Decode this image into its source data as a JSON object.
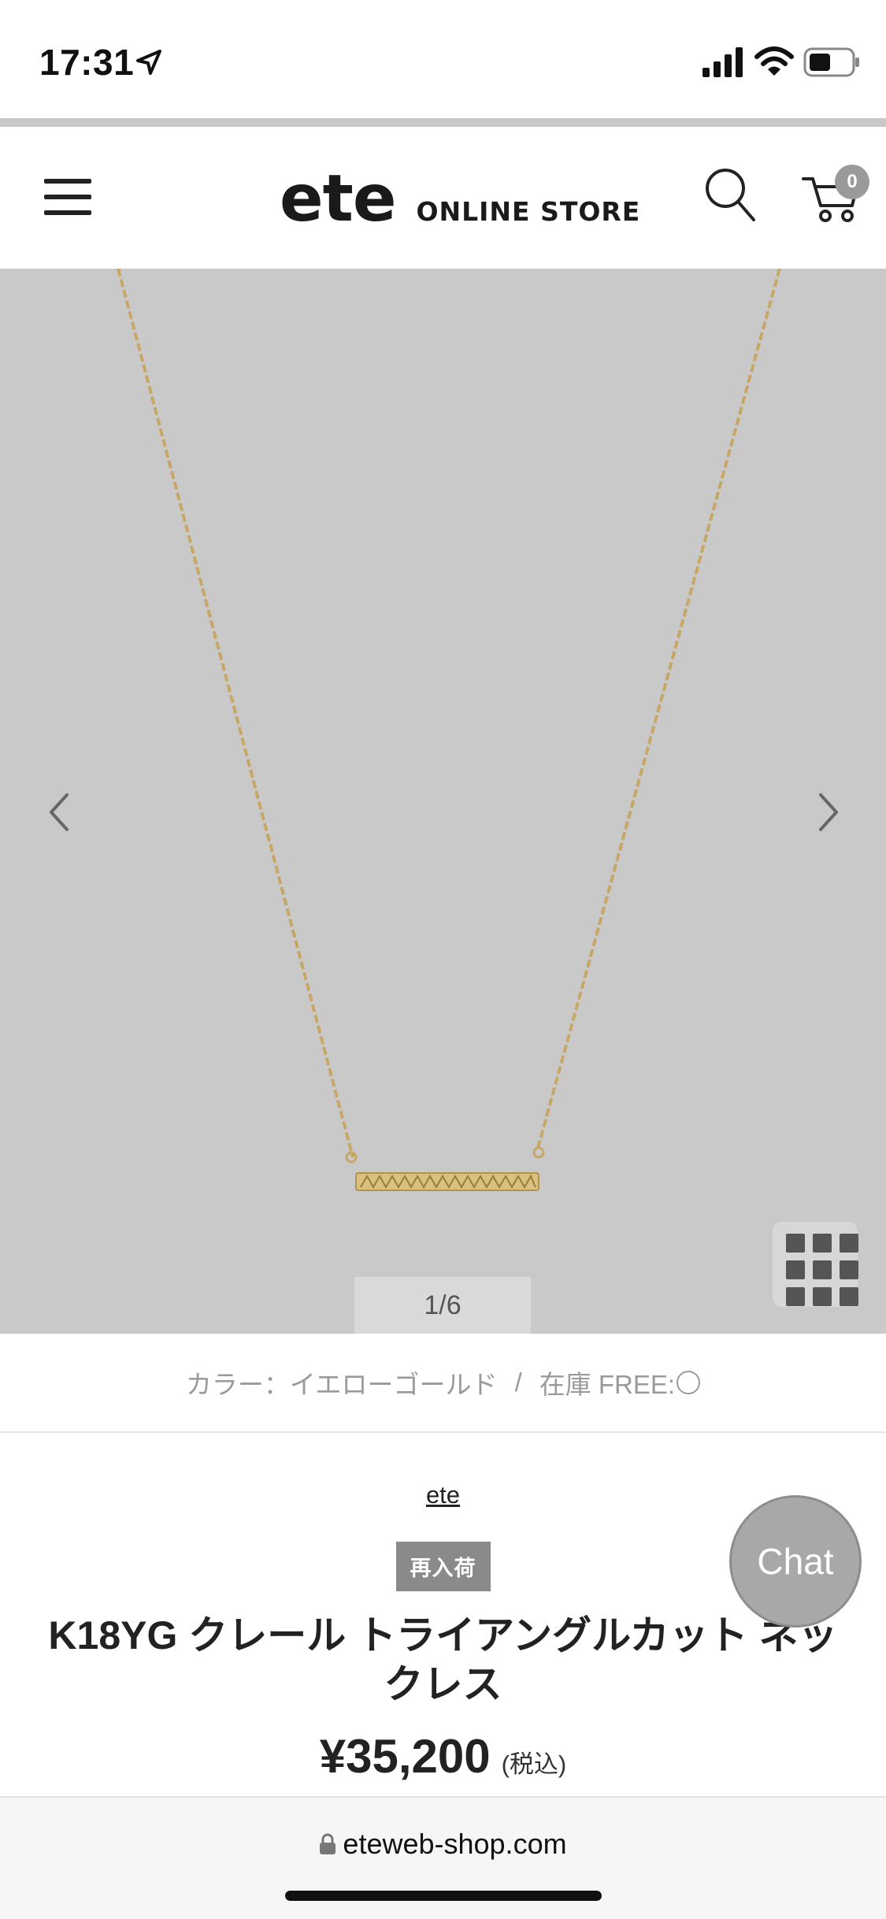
{
  "status_bar": {
    "time": "17:31"
  },
  "header": {
    "logo_mark": "ete",
    "logo_sub": "ONLINE STORE",
    "cart_count": "0"
  },
  "gallery": {
    "pager": "1/6",
    "background_color": "#c9c9c9",
    "chain_color": "#c7a766"
  },
  "product": {
    "color_label": "カラー：イエローゴールド",
    "separator": "/",
    "stock_label": "在庫  FREE:",
    "brand": "ete",
    "badge": "再入荷",
    "title": "K18YG クレール トライアングルカット ネックレス",
    "price": "¥35,200",
    "tax_note": "(税込)"
  },
  "chat": {
    "label": "Chat"
  },
  "browser": {
    "url": "eteweb-shop.com"
  }
}
